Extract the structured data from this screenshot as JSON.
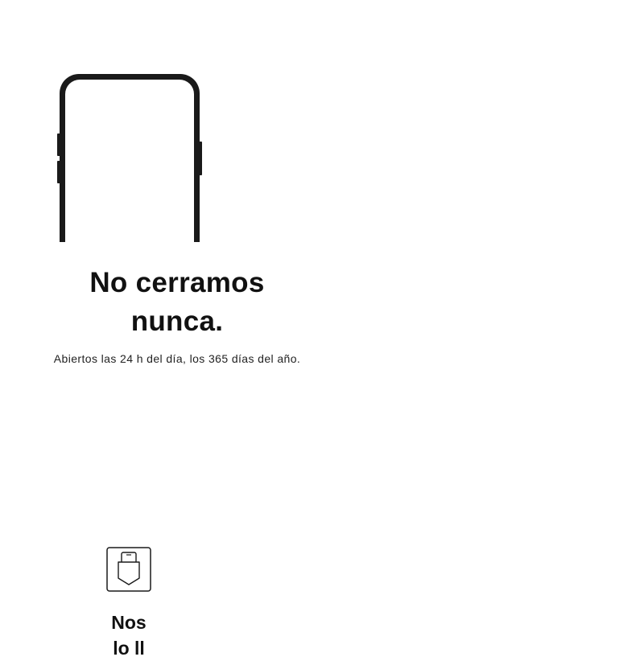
{
  "hero": {
    "image_icon": "phone-outline-icon",
    "title_line1": "No cerramos",
    "title_line2": "nunca.",
    "subtitle": "Abiertos las 24 h del día, los 365 días del año."
  },
  "feature": {
    "icon": "phone-in-pocket-icon",
    "title_line1": "Nos",
    "title_line2": "lo ll"
  }
}
